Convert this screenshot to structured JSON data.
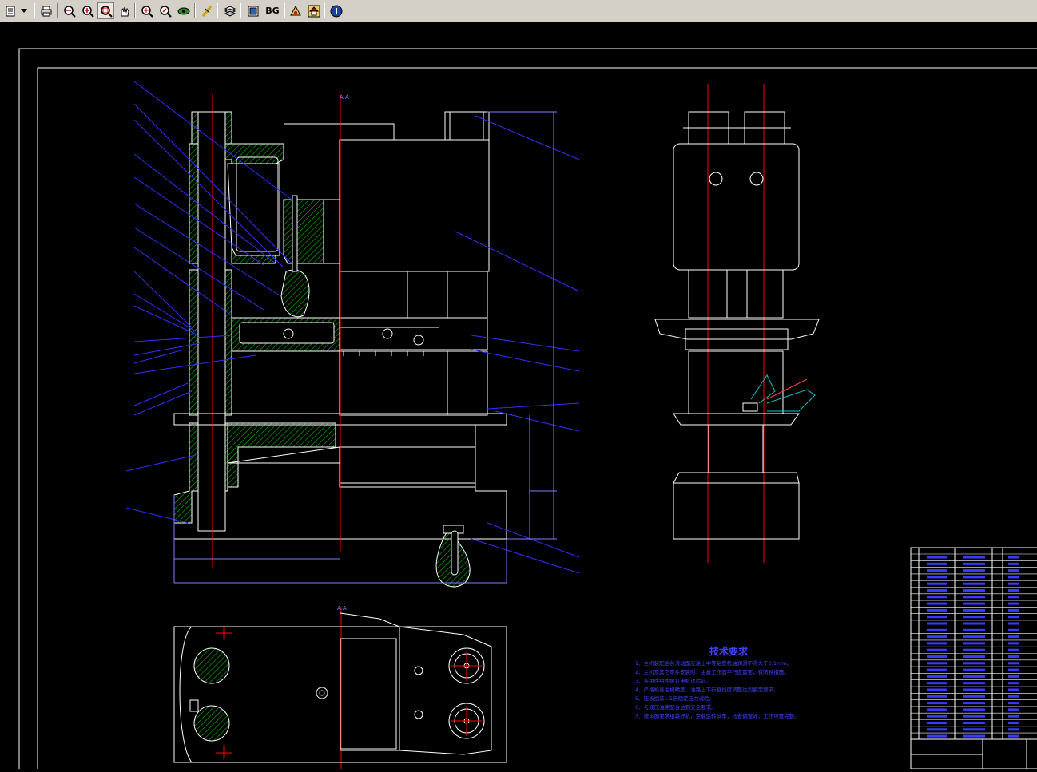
{
  "toolbar": {
    "bg_label": "BG",
    "buttons": [
      "open-icon",
      "dropdown-arrow-icon",
      "print-icon",
      "zoom-out-icon",
      "zoom-in-icon",
      "zoom-window-icon",
      "pan-icon",
      "zoom-extents-icon",
      "zoom-realtime-icon",
      "view-3d-icon",
      "measure-icon",
      "layers-icon",
      "display-icon",
      "background-color",
      "symbol-icon",
      "home-icon",
      "info-icon"
    ]
  },
  "drawing": {
    "tech_title": "技术要求",
    "tech_notes": [
      "1、主机装配后各滑动面应涂上中等粘度机油润滑不得大于0.1mm。",
      "2、主机及其它零件安装时，主板工作面平行度需要，有防锈措施。",
      "3、各组件组件螺钉电机试验前。",
      "4、严格检查主机精度，油路上下行直线度调整达到额定要求。",
      "5、压板组装1.5倍额定压力试验。",
      "6、与液压油路配合达到安全要求。",
      "7、按本图要求组装好机，空载运转试车，检查调整好，工作可靠完整。"
    ],
    "view_labels": [
      "A-A",
      "A-A"
    ],
    "colors": {
      "outline": "#ffffff",
      "hatch": "#00cc00",
      "leader": "#3030ff",
      "centerline": "#ff0000",
      "dim": "#8080ff",
      "text": "#4040ff"
    }
  }
}
